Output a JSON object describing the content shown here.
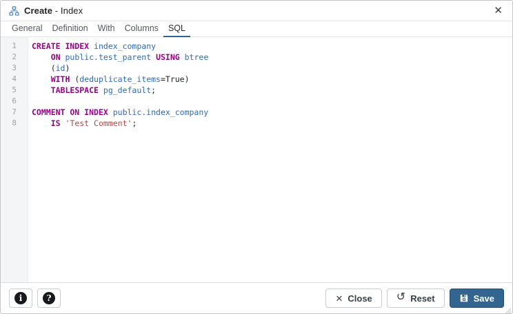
{
  "window": {
    "title": {
      "bold": "Create",
      "rest": " - Index"
    },
    "close_glyph": "✕"
  },
  "tabs": [
    {
      "label": "General",
      "active": false
    },
    {
      "label": "Definition",
      "active": false
    },
    {
      "label": "With",
      "active": false
    },
    {
      "label": "Columns",
      "active": false
    },
    {
      "label": "SQL",
      "active": true
    }
  ],
  "editor": {
    "language": "sql",
    "lines": [
      {
        "num": "1",
        "tokens": [
          {
            "text": "CREATE INDEX",
            "type": "keyword"
          },
          {
            "text": " ",
            "type": "plain"
          },
          {
            "text": "index_company",
            "type": "identifier"
          }
        ]
      },
      {
        "num": "2",
        "tokens": [
          {
            "text": "    ",
            "type": "plain"
          },
          {
            "text": "ON",
            "type": "keyword"
          },
          {
            "text": " ",
            "type": "plain"
          },
          {
            "text": "public.test_parent",
            "type": "identifier"
          },
          {
            "text": " ",
            "type": "plain"
          },
          {
            "text": "USING",
            "type": "keyword"
          },
          {
            "text": " ",
            "type": "plain"
          },
          {
            "text": "btree",
            "type": "identifier"
          }
        ]
      },
      {
        "num": "3",
        "tokens": [
          {
            "text": "    (",
            "type": "plain"
          },
          {
            "text": "id",
            "type": "identifier"
          },
          {
            "text": ")",
            "type": "plain"
          }
        ]
      },
      {
        "num": "4",
        "tokens": [
          {
            "text": "    ",
            "type": "plain"
          },
          {
            "text": "WITH",
            "type": "keyword"
          },
          {
            "text": " (",
            "type": "plain"
          },
          {
            "text": "deduplicate_items",
            "type": "identifier"
          },
          {
            "text": "=True)",
            "type": "plain"
          }
        ]
      },
      {
        "num": "5",
        "tokens": [
          {
            "text": "    ",
            "type": "plain"
          },
          {
            "text": "TABLESPACE",
            "type": "keyword"
          },
          {
            "text": " ",
            "type": "plain"
          },
          {
            "text": "pg_default",
            "type": "identifier"
          },
          {
            "text": ";",
            "type": "plain"
          }
        ]
      },
      {
        "num": "6",
        "tokens": []
      },
      {
        "num": "7",
        "tokens": [
          {
            "text": "COMMENT ON INDEX",
            "type": "keyword"
          },
          {
            "text": " ",
            "type": "plain"
          },
          {
            "text": "public.index_company",
            "type": "identifier"
          }
        ]
      },
      {
        "num": "8",
        "tokens": [
          {
            "text": "    ",
            "type": "plain"
          },
          {
            "text": "IS",
            "type": "keyword"
          },
          {
            "text": " ",
            "type": "plain"
          },
          {
            "text": "'Test Comment'",
            "type": "string"
          },
          {
            "text": ";",
            "type": "plain"
          }
        ]
      }
    ]
  },
  "footer": {
    "info_glyph": "i",
    "help_glyph": "?",
    "close_glyph": "✕",
    "reset_glyph": "↺",
    "close_label": "Close",
    "reset_label": "Reset",
    "save_label": "Save"
  },
  "colors": {
    "keyword": "#990088",
    "identifier": "#2f6bbf",
    "string": "#b04a42",
    "plain": "#1f2328",
    "primary_button": "#326690",
    "tab_active_underline": "#32628f",
    "title_icon": "#4d82c4"
  }
}
